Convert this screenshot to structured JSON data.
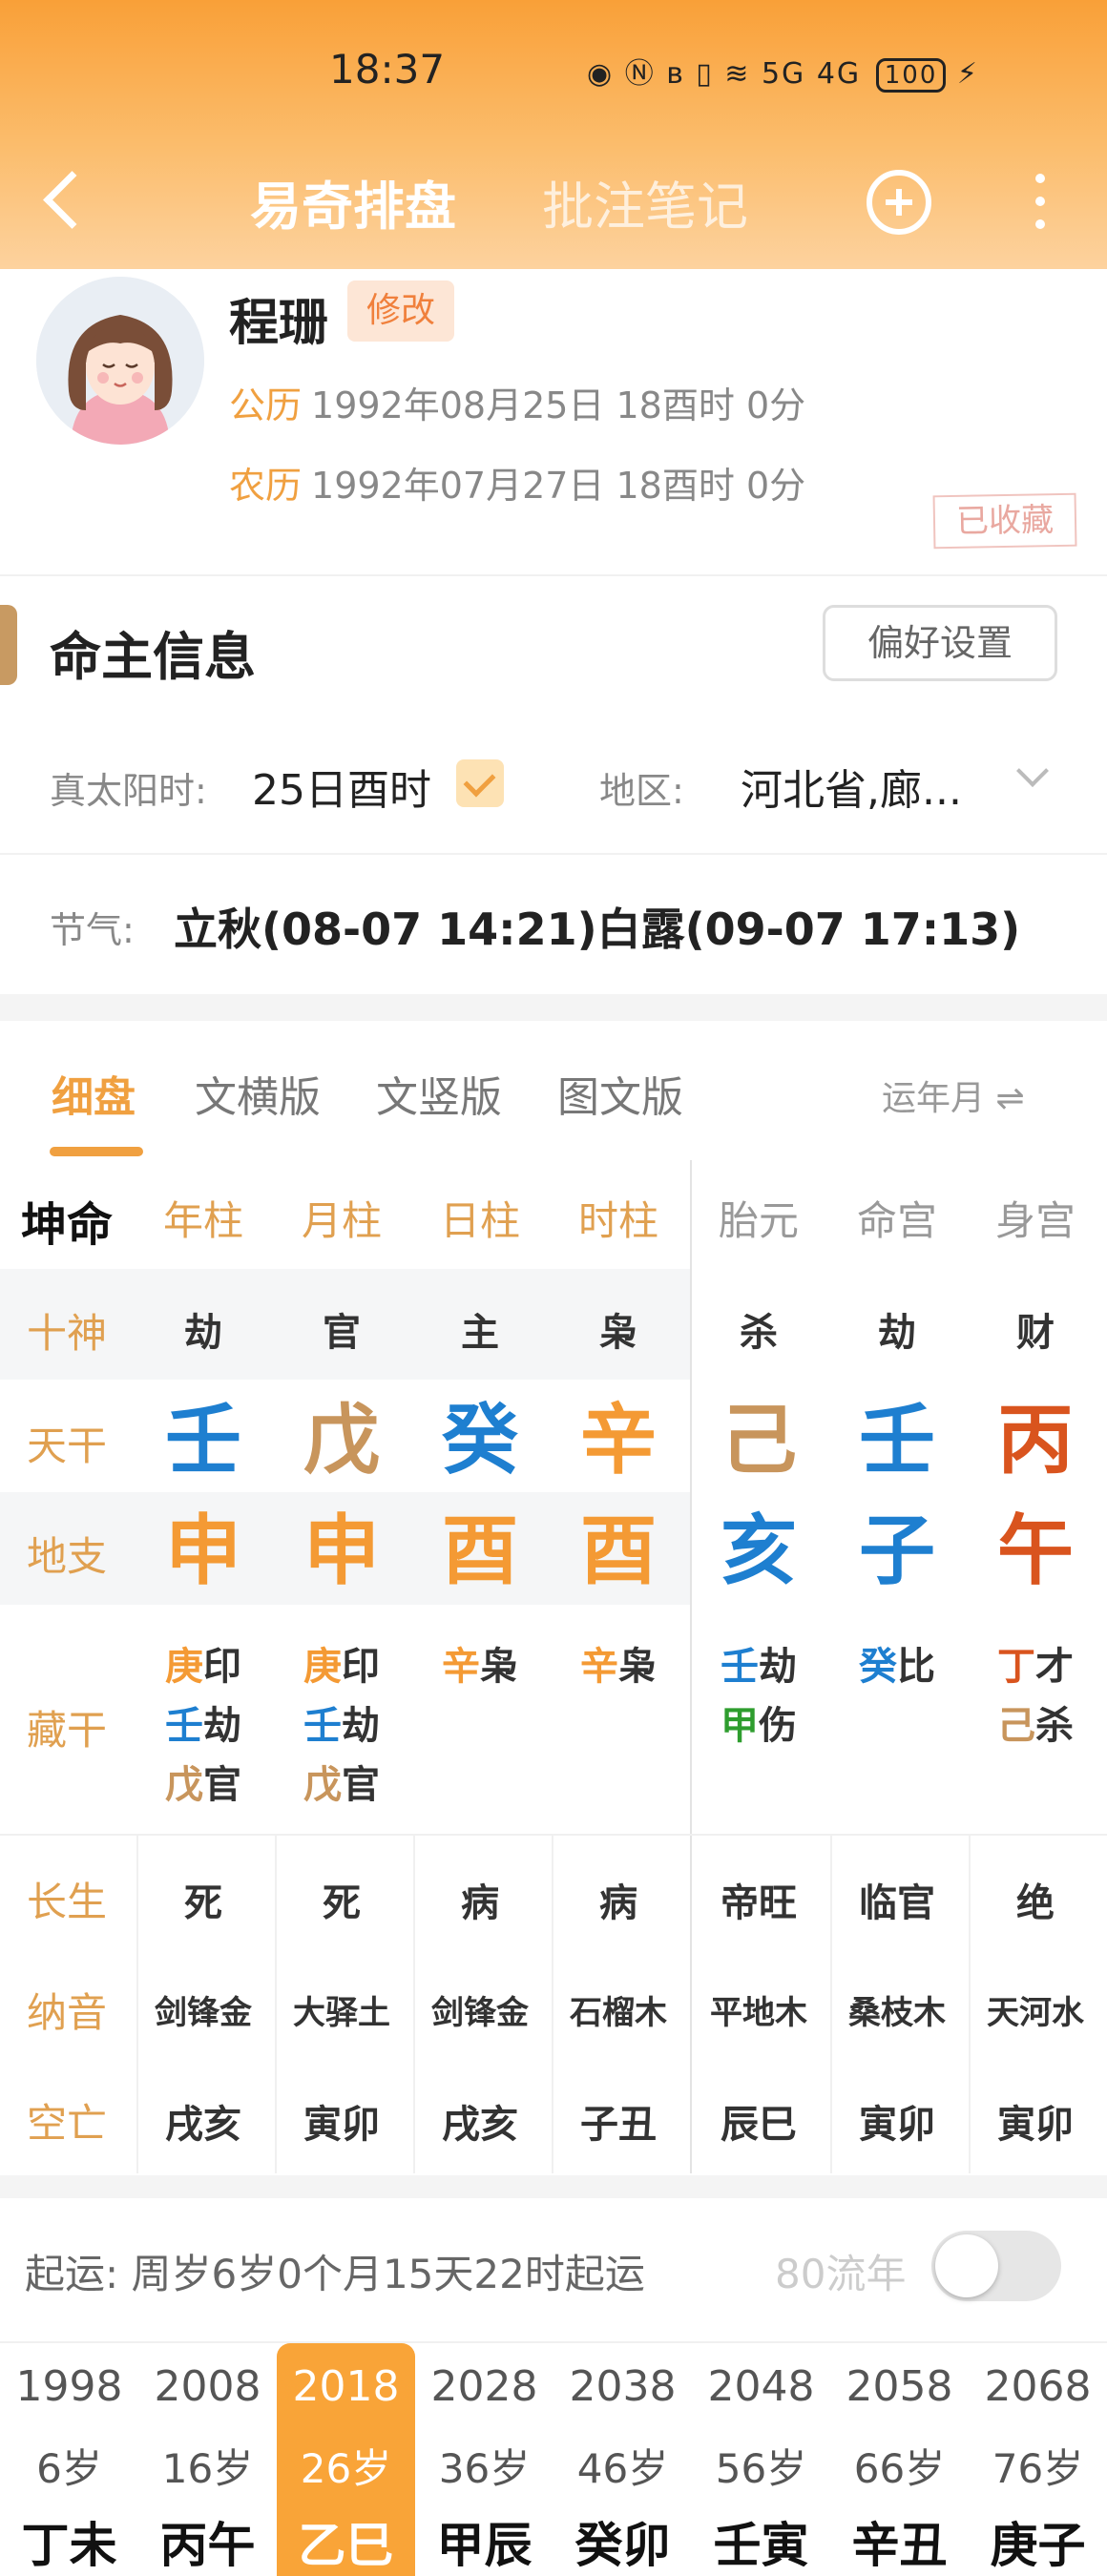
{
  "status_bar": {
    "time": "18:37",
    "network": "5G 4G",
    "battery": "100"
  },
  "header": {
    "tab_main": "易奇排盘",
    "tab_notes": "批注笔记"
  },
  "profile": {
    "name": "程珊",
    "edit_label": "修改",
    "solar_label": "公历",
    "solar_date": "1992年08月25日 18酉时 0分",
    "lunar_label": "农历",
    "lunar_date": "1992年07月27日 18酉时 0分",
    "stamp": "已收藏"
  },
  "owner_info": {
    "title": "命主信息",
    "pref_button": "偏好设置",
    "true_solar_label": "真太阳时:",
    "true_solar_value": "25日酉时",
    "region_label": "地区:",
    "region_value": "河北省,廊...",
    "solar_term_label": "节气:",
    "solar_term_value": "立秋(08-07 14:21)白露(09-07 17:13)"
  },
  "chart_tabs": [
    "细盘",
    "文横版",
    "文竖版",
    "图文版"
  ],
  "yun_label": "运年月 ⇌",
  "colors": {
    "accent": "#f9a038",
    "wood": "#1e7fd0",
    "earth": "#c8955c",
    "fire": "#d9541e",
    "metal": "#f49a34",
    "green": "#2e9d2e"
  },
  "bazi": {
    "corner_label": "坤命",
    "columns": [
      "年柱",
      "月柱",
      "日柱",
      "时柱",
      "胎元",
      "命宫",
      "身宫"
    ],
    "row_labels": [
      "十神",
      "天干",
      "地支",
      "藏干",
      "长生",
      "纳音",
      "空亡"
    ],
    "shishen": [
      "劫",
      "官",
      "主",
      "枭",
      "杀",
      "劫",
      "财"
    ],
    "tiangan": [
      "壬",
      "戊",
      "癸",
      "辛",
      "己",
      "壬",
      "丙"
    ],
    "dizhi": [
      "申",
      "申",
      "酉",
      "酉",
      "亥",
      "子",
      "午"
    ],
    "canggan": [
      [
        "庚印",
        "壬劫",
        "戊官"
      ],
      [
        "庚印",
        "壬劫",
        "戊官"
      ],
      [
        "辛枭"
      ],
      [
        "辛枭"
      ],
      [
        "壬劫",
        "甲伤"
      ],
      [
        "癸比"
      ],
      [
        "丁才",
        "己杀"
      ]
    ],
    "changsheng": [
      "死",
      "死",
      "病",
      "病",
      "帝旺",
      "临官",
      "绝"
    ],
    "nayin": [
      "剑锋金",
      "大驿土",
      "剑锋金",
      "石榴木",
      "平地木",
      "桑枝木",
      "天河水"
    ],
    "kongwang": [
      "戌亥",
      "寅卯",
      "戌亥",
      "子丑",
      "辰巳",
      "寅卯",
      "寅卯"
    ]
  },
  "luck": {
    "start_label": "起运:",
    "start_text": "周岁6岁0个月15天22时起运",
    "liunian_label": "80流年",
    "toggle_on": false,
    "selected_index": 2,
    "pillars": [
      {
        "year": "1998",
        "age": "6岁",
        "gz": "丁未"
      },
      {
        "year": "2008",
        "age": "16岁",
        "gz": "丙午"
      },
      {
        "year": "2018",
        "age": "26岁",
        "gz": "乙巳"
      },
      {
        "year": "2028",
        "age": "36岁",
        "gz": "甲辰"
      },
      {
        "year": "2038",
        "age": "46岁",
        "gz": "癸卯"
      },
      {
        "year": "2048",
        "age": "56岁",
        "gz": "壬寅"
      },
      {
        "year": "2058",
        "age": "66岁",
        "gz": "辛丑"
      },
      {
        "year": "2068",
        "age": "76岁",
        "gz": "庚子"
      }
    ]
  }
}
